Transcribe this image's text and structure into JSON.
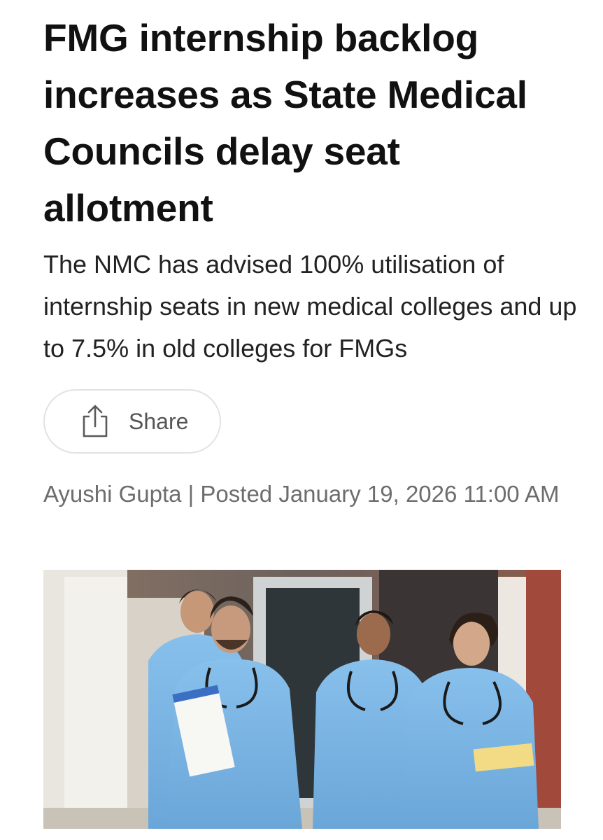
{
  "article": {
    "headline": "FMG internship backlog increases as State Medical Councils delay seat allotment",
    "subheadline": "The NMC has advised 100% utilisation of internship seats in new medical colleges and up to 7.5% in old colleges for FMGs",
    "share_label": "Share",
    "share_icon": "share-icon",
    "byline": "Ayushi Gupta | Posted January 19, 2026 11:00 AM"
  },
  "colors": {
    "headline": "#111111",
    "body_text": "#222222",
    "muted_text": "#6d6d6d",
    "scrubs": "#7cb7e6",
    "button_border": "#e2e2e2"
  }
}
